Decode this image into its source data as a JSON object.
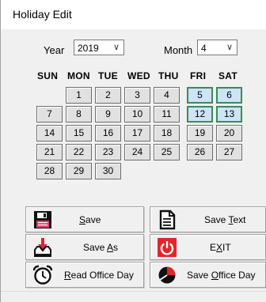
{
  "window": {
    "title": "Holiday Edit"
  },
  "year": {
    "label": "Year",
    "value": "2019"
  },
  "month": {
    "label": "Month",
    "value": "4"
  },
  "weekdays": [
    "SUN",
    "MON",
    "TUE",
    "WED",
    "THU",
    "FRI",
    "SAT"
  ],
  "days": [
    "1",
    "2",
    "3",
    "4",
    "5",
    "6",
    "7",
    "8",
    "9",
    "10",
    "11",
    "12",
    "13",
    "14",
    "15",
    "16",
    "17",
    "18",
    "19",
    "20",
    "21",
    "22",
    "23",
    "24",
    "25",
    "26",
    "27",
    "28",
    "29",
    "30"
  ],
  "buttons": {
    "save": {
      "pre": "",
      "key": "S",
      "post": "ave",
      "icon": "floppy-disk-icon"
    },
    "save_text": {
      "pre": "Save ",
      "key": "T",
      "post": "ext",
      "icon": "document-icon"
    },
    "save_as": {
      "pre": "Save ",
      "key": "A",
      "post": "s",
      "icon": "tray-down-arrow-icon"
    },
    "exit": {
      "pre": "E",
      "key": "X",
      "post": "IT",
      "icon": "power-icon"
    },
    "read_office_day": {
      "pre": "",
      "key": "R",
      "post": "ead Office Day",
      "icon": "alarm-clock-icon"
    },
    "save_office_day": {
      "pre": "Save ",
      "key": "O",
      "post": "ffice Day",
      "icon": "clock-icon"
    }
  },
  "colors": {
    "weekend_bg": "#cce4f7",
    "weekend_border": "#3c8a5a",
    "exit_red": "#e0262b"
  }
}
